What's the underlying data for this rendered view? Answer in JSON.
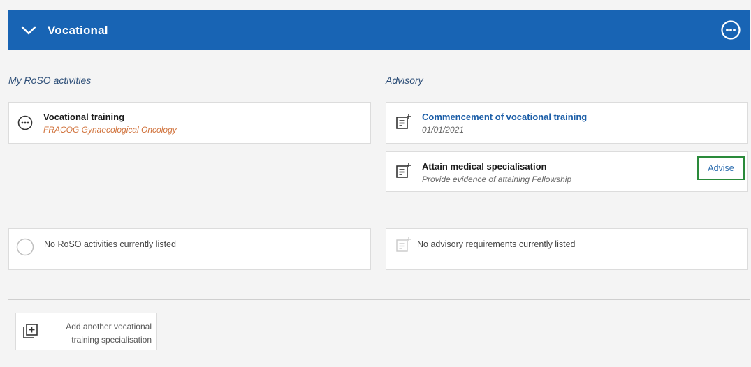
{
  "header": {
    "title": "Vocational"
  },
  "left_column": {
    "heading": "My RoSO activities",
    "activity": {
      "title": "Vocational training",
      "subtitle": "FRACOG Gynaecological Oncology"
    },
    "empty_text": "No RoSO activities currently listed"
  },
  "right_column": {
    "heading": "Advisory",
    "items": [
      {
        "title": "Commencement of vocational training",
        "subtitle": "01/01/2021"
      },
      {
        "title": "Attain medical specialisation",
        "subtitle": "Provide evidence of attaining Fellowship",
        "action": "Advise"
      }
    ],
    "empty_text": "No advisory requirements currently listed"
  },
  "add_button": {
    "line1": "Add another vocational",
    "line2": "training specialisation"
  },
  "colors": {
    "header_bg": "#1864b4",
    "accent_orange": "#d0713a",
    "link_blue": "#1d5fa8",
    "highlight_green": "#2a8a3a"
  }
}
